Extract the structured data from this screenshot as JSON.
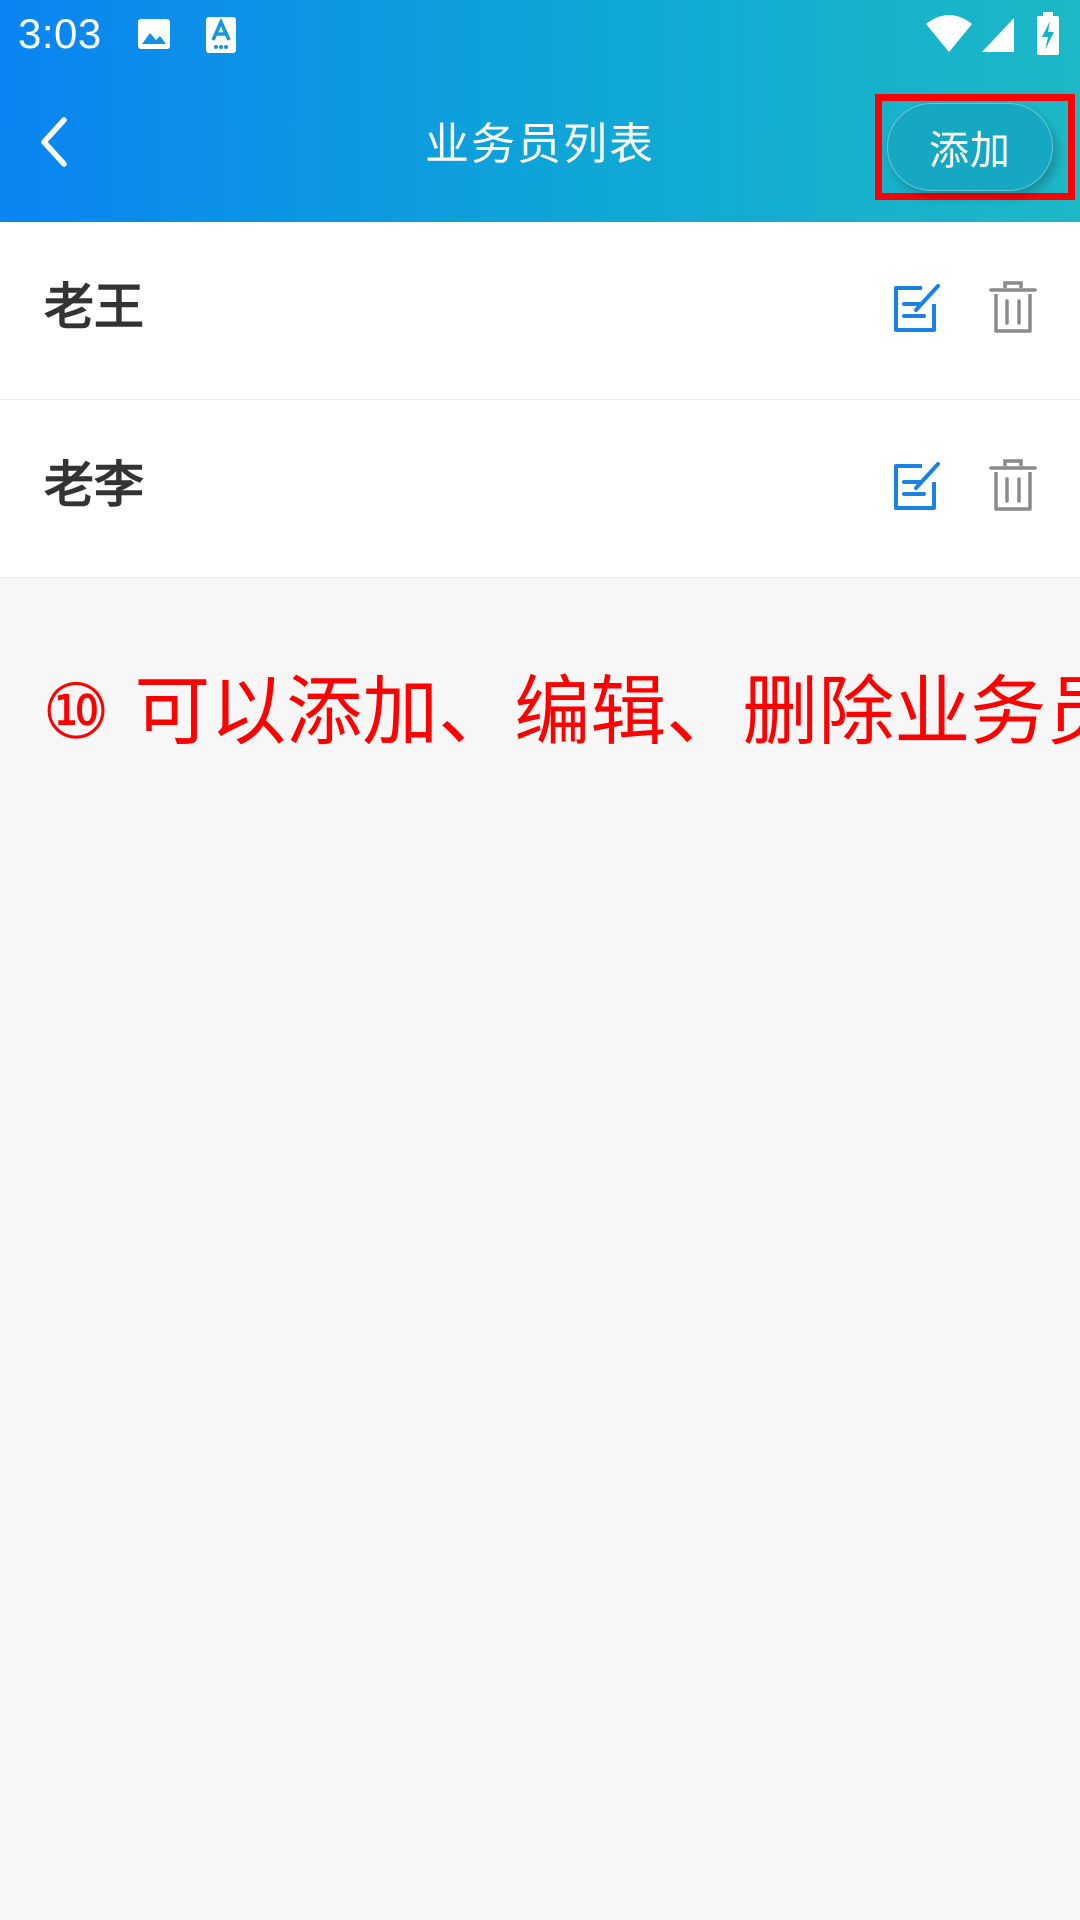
{
  "status_bar": {
    "time": "3:03",
    "left_icons": [
      "image-icon",
      "text-a-icon"
    ],
    "right_icons": [
      "wifi-icon",
      "cell-signal-icon",
      "battery-charging-icon"
    ]
  },
  "header": {
    "title": "业务员列表",
    "back_icon": "chevron-left-icon",
    "add_label": "添加"
  },
  "salespersons": [
    {
      "name": "老王",
      "edit_icon": "edit-icon",
      "delete_icon": "trash-icon"
    },
    {
      "name": "老李",
      "edit_icon": "edit-icon",
      "delete_icon": "trash-icon"
    }
  ],
  "annotation": {
    "text": "⑩ 可以添加、编辑、删除业务员"
  },
  "colors": {
    "header_gradient_start": "#0a84f2",
    "header_gradient_end": "#1db8c6",
    "edit_icon": "#1a82e2",
    "delete_icon": "#8a8a8a",
    "annotation": "#ff0000",
    "page_background": "#f7f7f7"
  }
}
